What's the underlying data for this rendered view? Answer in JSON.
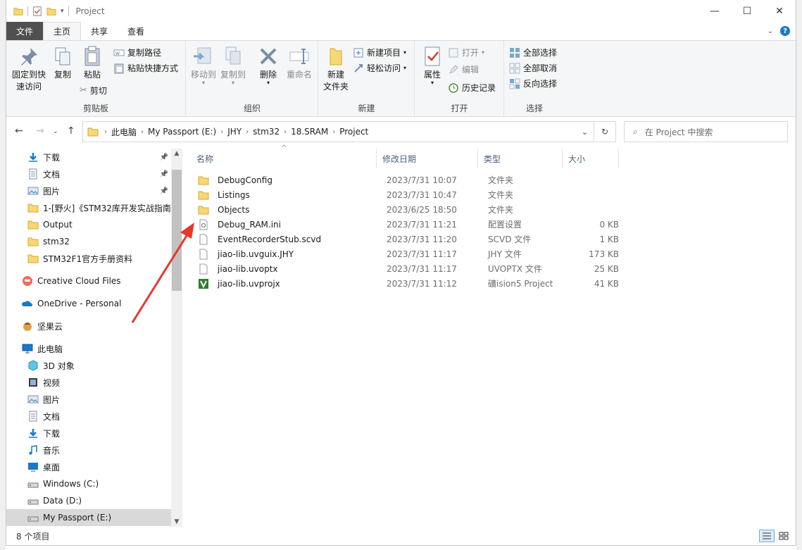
{
  "window": {
    "title": "Project",
    "controls": {
      "minimize": "—",
      "maximize": "☐",
      "close": "✕"
    }
  },
  "ribbon_tabs": [
    "文件",
    "主页",
    "共享",
    "查看"
  ],
  "ribbon": {
    "clipboard": {
      "label": "剪贴板",
      "pin": "固定到快\n速访问",
      "copy": "复制",
      "paste": "粘贴",
      "copy_path": "复制路径",
      "paste_shortcut": "粘贴快捷方式",
      "cut": "剪切"
    },
    "organize": {
      "label": "组织",
      "move_to": "移动到",
      "copy_to": "复制到",
      "delete": "删除",
      "rename": "重命名"
    },
    "new": {
      "label": "新建",
      "new_folder": "新建\n文件夹",
      "new_item": "新建项目",
      "easy_access": "轻松访问"
    },
    "open": {
      "label": "打开",
      "properties": "属性",
      "open": "打开",
      "edit": "编辑",
      "history": "历史记录"
    },
    "select": {
      "label": "选择",
      "select_all": "全部选择",
      "select_none": "全部取消",
      "invert": "反向选择"
    }
  },
  "address": {
    "crumbs": [
      "此电脑",
      "My Passport (E:)",
      "JHY",
      "stm32",
      "18.SRAM",
      "Project"
    ],
    "search_placeholder": "在 Project 中搜索"
  },
  "nav_pane": [
    {
      "label": "下载",
      "icon": "download-icon",
      "pinned": true
    },
    {
      "label": "文档",
      "icon": "document-icon",
      "pinned": true
    },
    {
      "label": "图片",
      "icon": "picture-icon",
      "pinned": true
    },
    {
      "label": "1-[野火]《STM32库开发实战指南",
      "icon": "folder-icon",
      "pinned": false
    },
    {
      "label": "Output",
      "icon": "folder-icon",
      "pinned": false
    },
    {
      "label": "stm32",
      "icon": "folder-icon",
      "pinned": false
    },
    {
      "label": "STM32F1官方手册资料",
      "icon": "folder-icon",
      "pinned": false
    },
    {
      "label": "Creative Cloud Files",
      "icon": "creative-cloud-icon",
      "pinned": false
    },
    {
      "label": "OneDrive - Personal",
      "icon": "onedrive-icon",
      "pinned": false
    },
    {
      "label": "坚果云",
      "icon": "nutstore-icon",
      "pinned": false
    },
    {
      "label": "此电脑",
      "icon": "computer-icon",
      "pinned": false
    },
    {
      "label": "3D 对象",
      "icon": "3d-objects-icon",
      "pinned": false
    },
    {
      "label": "视频",
      "icon": "video-icon",
      "pinned": false
    },
    {
      "label": "图片",
      "icon": "picture-icon",
      "pinned": false
    },
    {
      "label": "文档",
      "icon": "document-icon",
      "pinned": false
    },
    {
      "label": "下载",
      "icon": "download-icon",
      "pinned": false
    },
    {
      "label": "音乐",
      "icon": "music-icon",
      "pinned": false
    },
    {
      "label": "桌面",
      "icon": "desktop-icon",
      "pinned": false
    },
    {
      "label": "Windows (C:)",
      "icon": "drive-icon",
      "pinned": false
    },
    {
      "label": "Data (D:)",
      "icon": "drive-icon",
      "pinned": false
    },
    {
      "label": "My Passport (E:)",
      "icon": "drive-icon",
      "pinned": false,
      "selected": true
    }
  ],
  "columns": [
    "名称",
    "修改日期",
    "类型",
    "大小"
  ],
  "files": [
    {
      "name": "DebugConfig",
      "date": "2023/7/31 10:07",
      "type": "文件夹",
      "size": "",
      "icon": "folder-icon"
    },
    {
      "name": "Listings",
      "date": "2023/7/31 10:47",
      "type": "文件夹",
      "size": "",
      "icon": "folder-icon"
    },
    {
      "name": "Objects",
      "date": "2023/6/25 18:50",
      "type": "文件夹",
      "size": "",
      "icon": "folder-icon"
    },
    {
      "name": "Debug_RAM.ini",
      "date": "2023/7/31 11:21",
      "type": "配置设置",
      "size": "0 KB",
      "icon": "settings-file-icon"
    },
    {
      "name": "EventRecorderStub.scvd",
      "date": "2023/7/31 11:20",
      "type": "SCVD 文件",
      "size": "1 KB",
      "icon": "file-icon"
    },
    {
      "name": "jiao-lib.uvguix.JHY",
      "date": "2023/7/31 11:17",
      "type": "JHY 文件",
      "size": "173 KB",
      "icon": "file-icon"
    },
    {
      "name": "jiao-lib.uvoptx",
      "date": "2023/7/31 11:17",
      "type": "UVOPTX 文件",
      "size": "25 KB",
      "icon": "file-icon"
    },
    {
      "name": "jiao-lib.uvprojx",
      "date": "2023/7/31 11:12",
      "type": "礦ision5 Project",
      "size": "41 KB",
      "icon": "keil-project-icon"
    }
  ],
  "status": {
    "item_count": "8 个项目"
  },
  "colors": {
    "accent": "#1979ca",
    "folder": "#f8d775",
    "annotation_arrow": "#e8362c"
  }
}
